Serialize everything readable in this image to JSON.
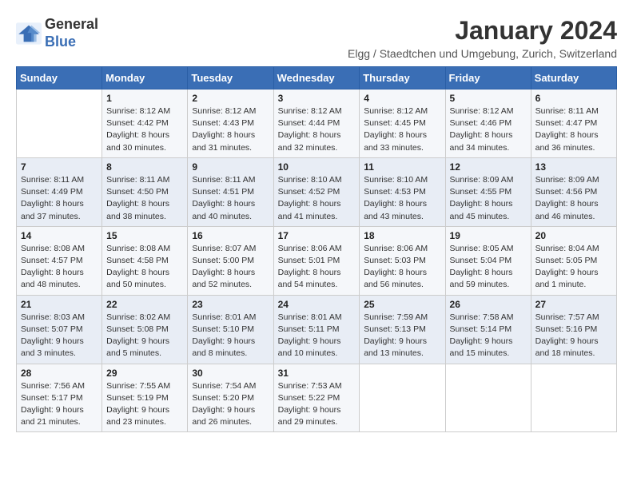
{
  "header": {
    "logo_line1": "General",
    "logo_line2": "Blue",
    "month_title": "January 2024",
    "subtitle": "Elgg / Staedtchen und Umgebung, Zurich, Switzerland"
  },
  "days_of_week": [
    "Sunday",
    "Monday",
    "Tuesday",
    "Wednesday",
    "Thursday",
    "Friday",
    "Saturday"
  ],
  "weeks": [
    [
      {
        "day": "",
        "info": ""
      },
      {
        "day": "1",
        "info": "Sunrise: 8:12 AM\nSunset: 4:42 PM\nDaylight: 8 hours\nand 30 minutes."
      },
      {
        "day": "2",
        "info": "Sunrise: 8:12 AM\nSunset: 4:43 PM\nDaylight: 8 hours\nand 31 minutes."
      },
      {
        "day": "3",
        "info": "Sunrise: 8:12 AM\nSunset: 4:44 PM\nDaylight: 8 hours\nand 32 minutes."
      },
      {
        "day": "4",
        "info": "Sunrise: 8:12 AM\nSunset: 4:45 PM\nDaylight: 8 hours\nand 33 minutes."
      },
      {
        "day": "5",
        "info": "Sunrise: 8:12 AM\nSunset: 4:46 PM\nDaylight: 8 hours\nand 34 minutes."
      },
      {
        "day": "6",
        "info": "Sunrise: 8:11 AM\nSunset: 4:47 PM\nDaylight: 8 hours\nand 36 minutes."
      }
    ],
    [
      {
        "day": "7",
        "info": "Sunrise: 8:11 AM\nSunset: 4:49 PM\nDaylight: 8 hours\nand 37 minutes."
      },
      {
        "day": "8",
        "info": "Sunrise: 8:11 AM\nSunset: 4:50 PM\nDaylight: 8 hours\nand 38 minutes."
      },
      {
        "day": "9",
        "info": "Sunrise: 8:11 AM\nSunset: 4:51 PM\nDaylight: 8 hours\nand 40 minutes."
      },
      {
        "day": "10",
        "info": "Sunrise: 8:10 AM\nSunset: 4:52 PM\nDaylight: 8 hours\nand 41 minutes."
      },
      {
        "day": "11",
        "info": "Sunrise: 8:10 AM\nSunset: 4:53 PM\nDaylight: 8 hours\nand 43 minutes."
      },
      {
        "day": "12",
        "info": "Sunrise: 8:09 AM\nSunset: 4:55 PM\nDaylight: 8 hours\nand 45 minutes."
      },
      {
        "day": "13",
        "info": "Sunrise: 8:09 AM\nSunset: 4:56 PM\nDaylight: 8 hours\nand 46 minutes."
      }
    ],
    [
      {
        "day": "14",
        "info": "Sunrise: 8:08 AM\nSunset: 4:57 PM\nDaylight: 8 hours\nand 48 minutes."
      },
      {
        "day": "15",
        "info": "Sunrise: 8:08 AM\nSunset: 4:58 PM\nDaylight: 8 hours\nand 50 minutes."
      },
      {
        "day": "16",
        "info": "Sunrise: 8:07 AM\nSunset: 5:00 PM\nDaylight: 8 hours\nand 52 minutes."
      },
      {
        "day": "17",
        "info": "Sunrise: 8:06 AM\nSunset: 5:01 PM\nDaylight: 8 hours\nand 54 minutes."
      },
      {
        "day": "18",
        "info": "Sunrise: 8:06 AM\nSunset: 5:03 PM\nDaylight: 8 hours\nand 56 minutes."
      },
      {
        "day": "19",
        "info": "Sunrise: 8:05 AM\nSunset: 5:04 PM\nDaylight: 8 hours\nand 59 minutes."
      },
      {
        "day": "20",
        "info": "Sunrise: 8:04 AM\nSunset: 5:05 PM\nDaylight: 9 hours\nand 1 minute."
      }
    ],
    [
      {
        "day": "21",
        "info": "Sunrise: 8:03 AM\nSunset: 5:07 PM\nDaylight: 9 hours\nand 3 minutes."
      },
      {
        "day": "22",
        "info": "Sunrise: 8:02 AM\nSunset: 5:08 PM\nDaylight: 9 hours\nand 5 minutes."
      },
      {
        "day": "23",
        "info": "Sunrise: 8:01 AM\nSunset: 5:10 PM\nDaylight: 9 hours\nand 8 minutes."
      },
      {
        "day": "24",
        "info": "Sunrise: 8:01 AM\nSunset: 5:11 PM\nDaylight: 9 hours\nand 10 minutes."
      },
      {
        "day": "25",
        "info": "Sunrise: 7:59 AM\nSunset: 5:13 PM\nDaylight: 9 hours\nand 13 minutes."
      },
      {
        "day": "26",
        "info": "Sunrise: 7:58 AM\nSunset: 5:14 PM\nDaylight: 9 hours\nand 15 minutes."
      },
      {
        "day": "27",
        "info": "Sunrise: 7:57 AM\nSunset: 5:16 PM\nDaylight: 9 hours\nand 18 minutes."
      }
    ],
    [
      {
        "day": "28",
        "info": "Sunrise: 7:56 AM\nSunset: 5:17 PM\nDaylight: 9 hours\nand 21 minutes."
      },
      {
        "day": "29",
        "info": "Sunrise: 7:55 AM\nSunset: 5:19 PM\nDaylight: 9 hours\nand 23 minutes."
      },
      {
        "day": "30",
        "info": "Sunrise: 7:54 AM\nSunset: 5:20 PM\nDaylight: 9 hours\nand 26 minutes."
      },
      {
        "day": "31",
        "info": "Sunrise: 7:53 AM\nSunset: 5:22 PM\nDaylight: 9 hours\nand 29 minutes."
      },
      {
        "day": "",
        "info": ""
      },
      {
        "day": "",
        "info": ""
      },
      {
        "day": "",
        "info": ""
      }
    ]
  ]
}
